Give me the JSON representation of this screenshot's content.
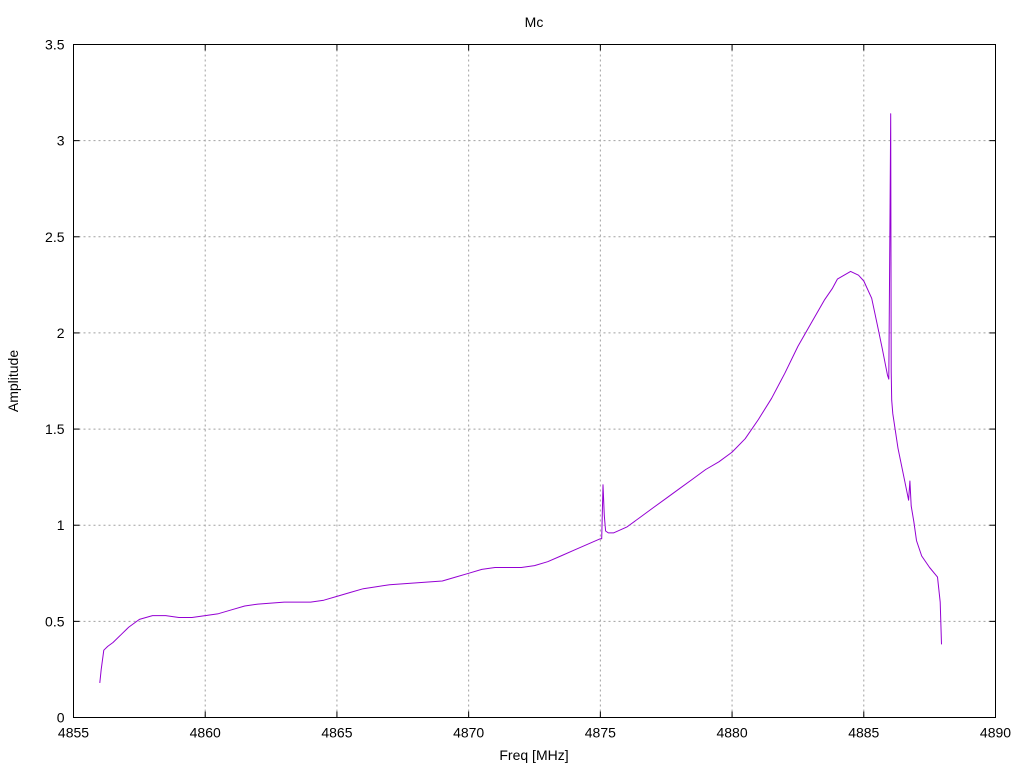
{
  "chart_data": {
    "type": "line",
    "title": "Mc",
    "xlabel": "Freq [MHz]",
    "ylabel": "Amplitude",
    "xlim": [
      4855,
      4890
    ],
    "ylim": [
      0,
      3.5
    ],
    "xticks": [
      4855,
      4860,
      4865,
      4870,
      4875,
      4880,
      4885,
      4890
    ],
    "xtick_labels": [
      "4855",
      "4860",
      "4865",
      "4870",
      "4875",
      "4880",
      "4885",
      "4890"
    ],
    "yticks": [
      0,
      0.5,
      1,
      1.5,
      2,
      2.5,
      3,
      3.5
    ],
    "ytick_labels": [
      "0",
      "0.5",
      "1",
      "1.5",
      "2",
      "2.5",
      "3",
      "3.5"
    ],
    "grid": true,
    "series": [
      {
        "color": "#9400d3",
        "x": [
          4856.0,
          4856.05,
          4856.15,
          4856.3,
          4856.5,
          4856.8,
          4857.1,
          4857.5,
          4858.0,
          4858.5,
          4859.0,
          4859.5,
          4860.0,
          4860.5,
          4861.0,
          4861.5,
          4862.0,
          4863.0,
          4864.0,
          4864.5,
          4865.0,
          4865.5,
          4866.0,
          4866.5,
          4867.0,
          4868.0,
          4869.0,
          4869.5,
          4870.0,
          4870.5,
          4871.0,
          4871.5,
          4872.0,
          4872.5,
          4873.0,
          4873.5,
          4874.0,
          4874.5,
          4875.0,
          4875.05,
          4875.1,
          4875.15,
          4875.2,
          4875.3,
          4875.5,
          4876.0,
          4876.5,
          4877.0,
          4877.5,
          4878.0,
          4878.5,
          4879.0,
          4879.5,
          4880.0,
          4880.5,
          4881.0,
          4881.5,
          4882.0,
          4882.5,
          4883.0,
          4883.5,
          4883.8,
          4884.0,
          4884.5,
          4884.8,
          4885.0,
          4885.3,
          4885.5,
          4885.7,
          4885.9,
          4885.95,
          4886.0,
          4886.02,
          4886.04,
          4886.06,
          4886.1,
          4886.3,
          4886.6,
          4886.7,
          4886.75,
          4886.8,
          4886.9,
          4887.0,
          4887.2,
          4887.5,
          4887.8,
          4887.9,
          4887.95
        ],
        "y": [
          0.18,
          0.25,
          0.35,
          0.37,
          0.39,
          0.43,
          0.47,
          0.51,
          0.53,
          0.53,
          0.52,
          0.52,
          0.53,
          0.54,
          0.56,
          0.58,
          0.59,
          0.6,
          0.6,
          0.61,
          0.63,
          0.65,
          0.67,
          0.68,
          0.69,
          0.7,
          0.71,
          0.73,
          0.75,
          0.77,
          0.78,
          0.78,
          0.78,
          0.79,
          0.81,
          0.84,
          0.87,
          0.9,
          0.93,
          0.93,
          1.21,
          1.05,
          0.97,
          0.96,
          0.96,
          0.99,
          1.04,
          1.09,
          1.14,
          1.19,
          1.24,
          1.29,
          1.33,
          1.38,
          1.45,
          1.55,
          1.66,
          1.79,
          1.93,
          2.05,
          2.17,
          2.23,
          2.28,
          2.32,
          2.3,
          2.27,
          2.18,
          2.05,
          1.92,
          1.78,
          1.76,
          2.68,
          3.14,
          1.8,
          1.65,
          1.58,
          1.4,
          1.2,
          1.13,
          1.23,
          1.1,
          1.02,
          0.92,
          0.84,
          0.78,
          0.73,
          0.6,
          0.38
        ]
      }
    ]
  }
}
